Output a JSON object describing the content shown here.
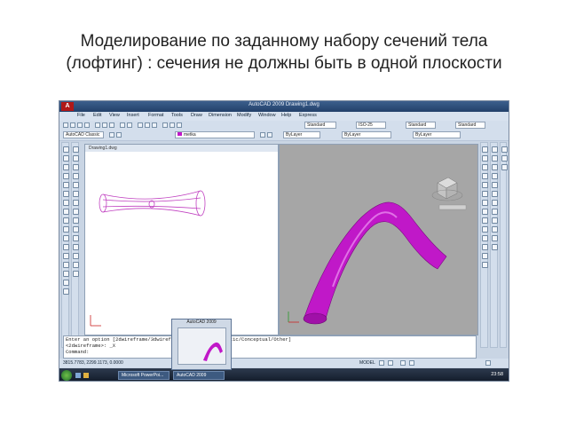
{
  "slide": {
    "title_line1": "Моделирование по заданному набору сечений тела",
    "title_line2": "(лофтинг) : сечения не должны быть в одной плоскости"
  },
  "app": {
    "logo": "A",
    "window_title": "AutoCAD 2009 Drawing1.dwg",
    "menu": [
      "File",
      "Edit",
      "View",
      "Insert",
      "Format",
      "Tools",
      "Draw",
      "Dimension",
      "Modify",
      "Window",
      "Help",
      "Express"
    ],
    "workspace": "AutoCAD Classic",
    "text_style": "Standard",
    "dim_style": "ISO-25",
    "table_style": "Standard",
    "multileader_style": "Standard",
    "layer": "metka",
    "color": "ByLayer",
    "linetype": "ByLayer",
    "lineweight": "ByLayer",
    "document_tab": "Drawing1.dwg",
    "command_lines": [
      "Enter an option [2dwireframe/3dwireframe/3dHidden/Realistic/Conceptual/Other]",
      "<2dwireframe>: _X",
      "Command:"
    ],
    "coordinates": "3815.7783, 2299.1173, 0.0000",
    "status_model": "MODEL"
  },
  "taskbar": {
    "items": [
      "Microsoft PowerPoi...",
      "AutoCAD 2009"
    ],
    "thumbnail_title": "AutoCAD 2009",
    "clock": "23:58"
  },
  "colors": {
    "solid": "#c018c8",
    "viewport_bg": "#a6a6a6",
    "loft_outline": "#c040c0"
  }
}
